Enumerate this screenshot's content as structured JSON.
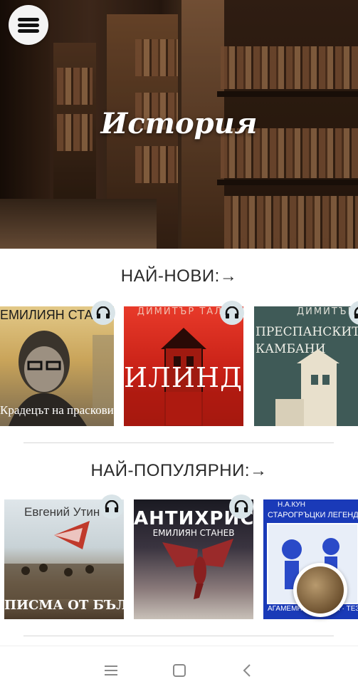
{
  "header": {
    "title": "История",
    "menu_icon": "hamburger-menu-icon"
  },
  "sections": [
    {
      "title": "НАЙ-НОВИ:→",
      "books": [
        {
          "author": "ЕМИЛИЯН СТАН",
          "title": "Крадецът на праскови",
          "audio_icon": "headphones-icon"
        },
        {
          "author": "ДИМИТЪР ТАЛЕ",
          "title": "ИЛИНДЕН",
          "audio_icon": "headphones-icon"
        },
        {
          "author": "ДИМИТЪР Т",
          "title_line1": "ПРЕСПАНСКИТЕ",
          "title_line2": "КАМБАНИ",
          "audio_icon": "headphones-icon"
        }
      ]
    },
    {
      "title": "НАЙ-ПОПУЛЯРНИ:→",
      "books": [
        {
          "author": "Евгений Утин",
          "title": "ПИСМА ОТ БЪЛГАРИЯ",
          "audio_icon": "headphones-icon"
        },
        {
          "author": "ЕМИЛИЯН СТАНЕВ",
          "title": "АНТИХРИСТ",
          "audio_icon": "headphones-icon"
        },
        {
          "author": "Н.А.КУН",
          "title": "СТАРОГРЪЦКИ ЛЕГЕНДИ И МИ",
          "bottom": "АГАМЕМНОН · ЯСОН · ТЕЗЕЙ · СИН"
        }
      ]
    }
  ],
  "mini_player": {
    "icon": "now-playing-cover"
  },
  "system_nav": {
    "menu_icon": "recent-apps-icon",
    "home_icon": "home-icon",
    "back_icon": "back-icon"
  },
  "colors": {
    "hero_title": "#ffffff",
    "section_title": "#2a2a2a",
    "headphones_bg": "#d9e4e8"
  }
}
